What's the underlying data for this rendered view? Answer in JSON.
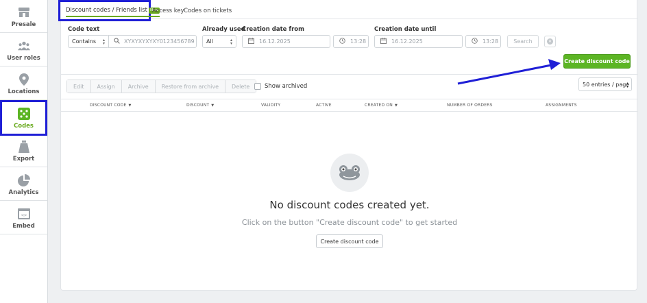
{
  "sidebar": {
    "items": [
      {
        "label": "Presale",
        "icon": "store-icon"
      },
      {
        "label": "User roles",
        "icon": "users-icon"
      },
      {
        "label": "Locations",
        "icon": "location-pin-icon"
      },
      {
        "label": "Codes",
        "icon": "dice-icon",
        "active": true
      },
      {
        "label": "Export",
        "icon": "bag-icon"
      },
      {
        "label": "Analytics",
        "icon": "pie-chart-icon"
      },
      {
        "label": "Embed",
        "icon": "code-window-icon"
      }
    ]
  },
  "tabs": {
    "discount": "Discount codes / Friends list",
    "new_badge": "New",
    "access_key": "Access key",
    "codes_on_tickets": "Codes on tickets"
  },
  "filters": {
    "code_text_label": "Code text",
    "code_text_mode": "Contains",
    "code_text_placeholder": "XYXYXYXYXY0123456789",
    "already_used_label": "Already used",
    "already_used_value": "All",
    "creation_from_label": "Creation date from",
    "creation_from_date": "16.12.2025",
    "creation_from_time": "13:28",
    "creation_until_label": "Creation date until",
    "creation_until_date": "16.12.2025",
    "creation_until_time": "13:28",
    "search_button": "Search"
  },
  "create_button": "Create discount code",
  "actions": {
    "edit": "Edit",
    "assign": "Assign",
    "archive": "Archive",
    "restore": "Restore from archive",
    "delete": "Delete",
    "show_archived": "Show archived"
  },
  "entries_per_page": "50 entries / page",
  "table": {
    "columns": [
      "DISCOUNT CODE",
      "DISCOUNT",
      "VALIDITY",
      "ACTIVE",
      "CREATED ON",
      "NUMBER OF ORDERS",
      "ASSIGNMENTS"
    ]
  },
  "empty_state": {
    "title": "No discount codes created yet.",
    "subtitle": "Click on the button \"Create discount code\" to get started",
    "button": "Create discount code"
  },
  "colors": {
    "accent_green": "#5cb524",
    "annotation_blue": "#1f1fd6"
  }
}
